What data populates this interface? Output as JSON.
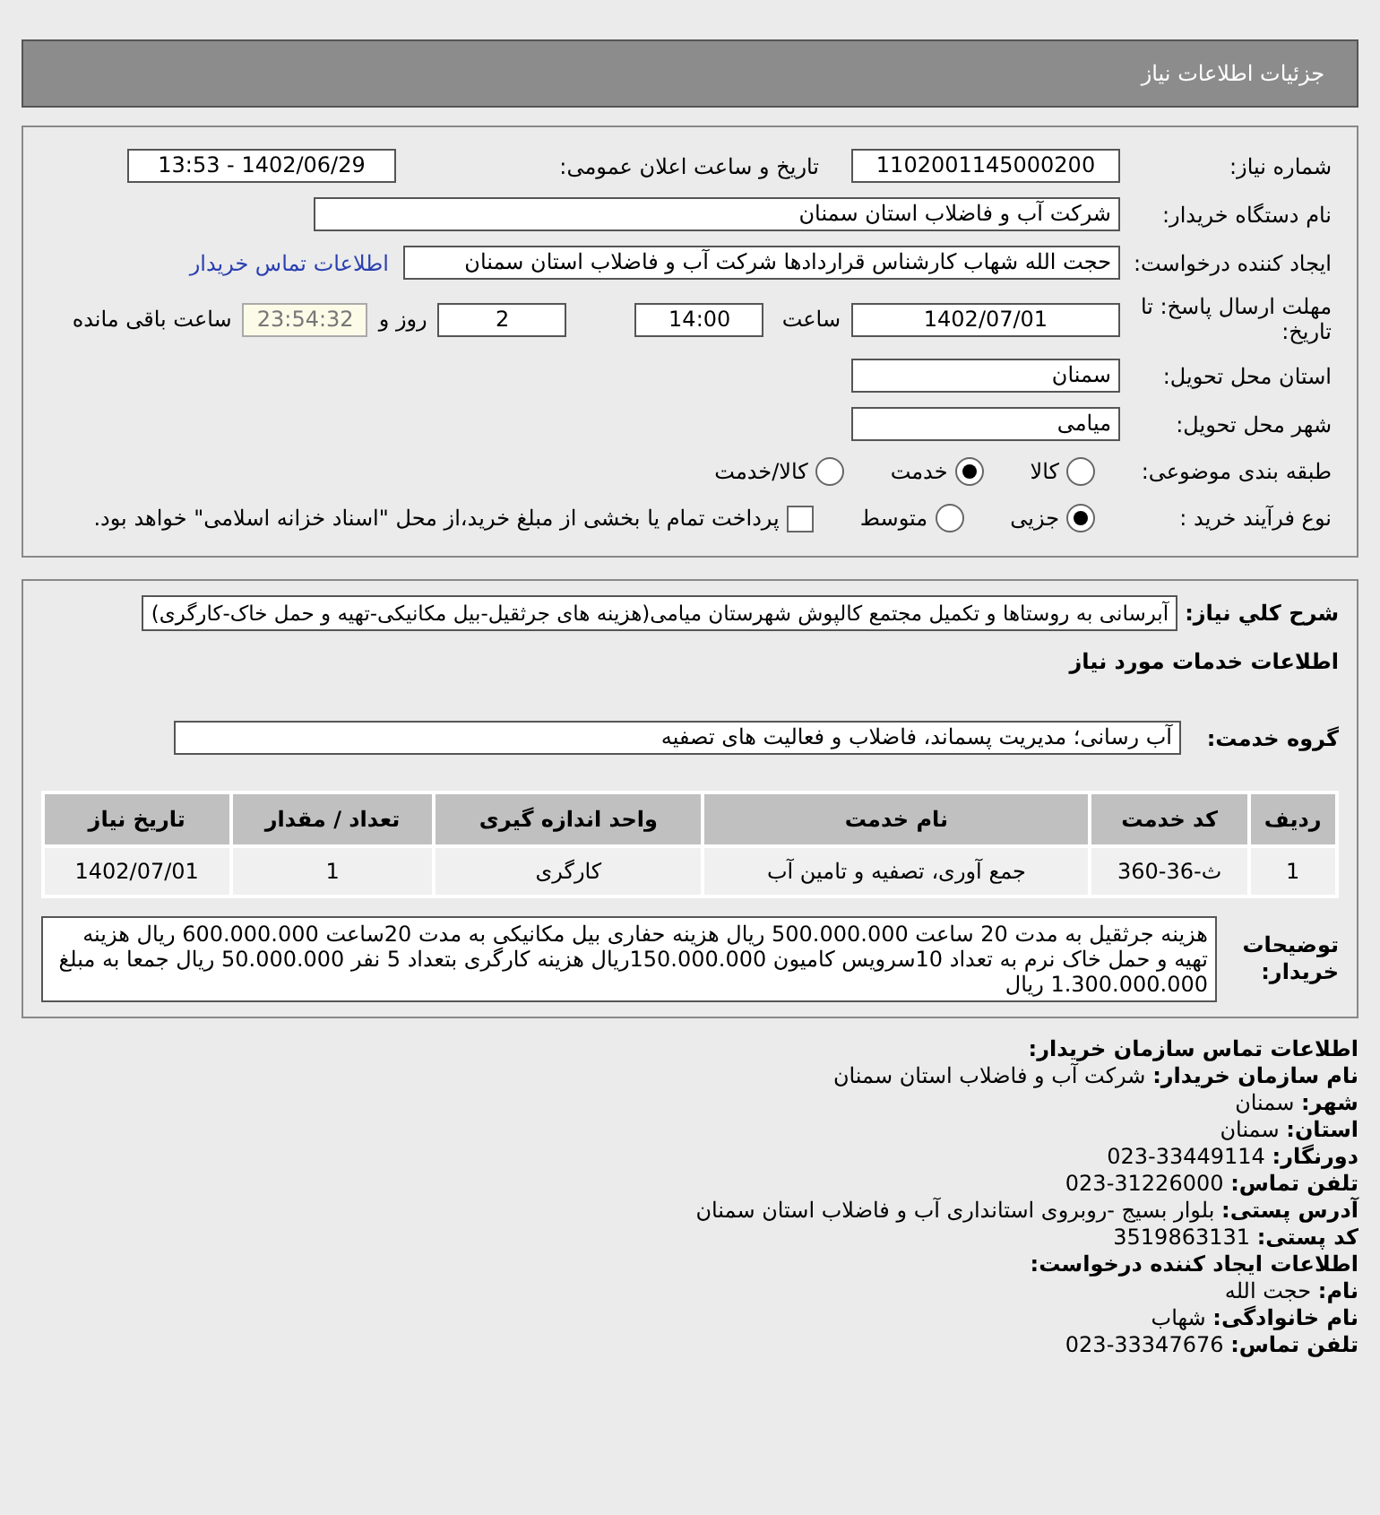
{
  "header": {
    "title": "جزئیات اطلاعات نیاز"
  },
  "need_number": {
    "label": "شماره نیاز:",
    "value": "1102001145000200"
  },
  "announce": {
    "label": "تاریخ و ساعت اعلان عمومی:",
    "value": "1402/06/29 - 13:53"
  },
  "buyer": {
    "label": "نام دستگاه خریدار:",
    "value": "شرکت آب و فاضلاب استان سمنان"
  },
  "creator": {
    "label": "ایجاد کننده درخواست:",
    "value": "حجت الله شهاب کارشناس قراردادها شرکت آب و فاضلاب استان سمنان",
    "link": "اطلاعات تماس خریدار"
  },
  "deadline": {
    "label": "مهلت ارسال پاسخ: تا تاریخ:",
    "date": "1402/07/01",
    "time_label": "ساعت",
    "time": "14:00",
    "days": "2",
    "days_label": "روز و",
    "remaining": "23:54:32",
    "remaining_label": "ساعت باقی مانده"
  },
  "province": {
    "label": "استان محل تحویل:",
    "value": "سمنان"
  },
  "city": {
    "label": "شهر محل تحویل:",
    "value": "میامی"
  },
  "category": {
    "label": "طبقه بندی موضوعی:",
    "options": [
      {
        "label": "کالا",
        "selected": false
      },
      {
        "label": "خدمت",
        "selected": true
      },
      {
        "label": "کالا/خدمت",
        "selected": false
      }
    ]
  },
  "process": {
    "label": "نوع فرآیند خرید :",
    "options": [
      {
        "label": "جزیی",
        "selected": true
      },
      {
        "label": "متوسط",
        "selected": false
      }
    ],
    "payment": {
      "label": "پرداخت تمام یا بخشی از مبلغ خرید،از محل \"اسناد خزانه اسلامی\" خواهد بود.",
      "checked": false
    }
  },
  "summary": {
    "label": "شرح کلي نياز:",
    "value": "آبرسانی به روستاها و تکمیل مجتمع کالپوش شهرستان میامی(هزینه های جرثقیل-بیل مکانیکی-تهیه و حمل خاک-کارگری)"
  },
  "services_title": "اطلاعات خدمات مورد نیاز",
  "service_group": {
    "label": "گروه خدمت:",
    "value": "آب رسانی؛ مدیریت پسماند، فاضلاب و فعالیت های تصفیه"
  },
  "table": {
    "columns": [
      "ردیف",
      "کد خدمت",
      "نام خدمت",
      "واحد اندازه گیری",
      "تعداد / مقدار",
      "تاریخ نیاز"
    ],
    "rows": [
      [
        "1",
        "ث-36-360",
        "جمع آوری، تصفیه و تامین آب",
        "کارگری",
        "1",
        "1402/07/01"
      ]
    ]
  },
  "buyer_notes": {
    "label": "توضیحات خریدار:",
    "value": "هزینه جرثقیل به مدت 20 ساعت 500.000.000 ریال هزینه حفاری بیل مکانیکی به مدت 20ساعت 600.000.000 ریال هزینه تهیه و حمل خاک نرم به تعداد 10سرویس کامیون 150.000.000ریال هزینه کارگری بتعداد 5 نفر 50.000.000 ریال جمعا به مبلغ 1.300.000.000 ریال"
  },
  "contact": [
    {
      "kind": "heading",
      "label": "اطلاعات تماس سازمان خریدار:"
    },
    {
      "kind": "line",
      "label": "نام سازمان خریدار:",
      "value": "شرکت آب و فاضلاب استان سمنان"
    },
    {
      "kind": "line",
      "label": "شهر:",
      "value": "سمنان"
    },
    {
      "kind": "line",
      "label": "استان:",
      "value": "سمنان"
    },
    {
      "kind": "line",
      "label": "دورنگار:",
      "value": "33449114-023"
    },
    {
      "kind": "line",
      "label": "تلفن تماس:",
      "value": "31226000-023"
    },
    {
      "kind": "line",
      "label": "آدرس پستی:",
      "value": "بلوار بسیج -روبروی استانداری آب و فاضلاب استان سمنان"
    },
    {
      "kind": "line",
      "label": "کد پستی:",
      "value": "3519863131"
    },
    {
      "kind": "heading",
      "label": "اطلاعات ایجاد کننده درخواست:"
    },
    {
      "kind": "line",
      "label": "نام:",
      "value": "حجت الله"
    },
    {
      "kind": "line",
      "label": "نام خانوادگی:",
      "value": "شهاب"
    },
    {
      "kind": "line",
      "label": "تلفن تماس:",
      "value": "33347676-023"
    }
  ]
}
